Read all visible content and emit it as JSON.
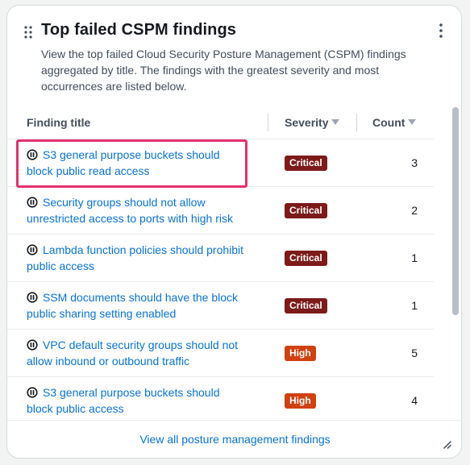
{
  "widget": {
    "title": "Top failed CSPM findings",
    "description": "View the top failed Cloud Security Posture Management (CSPM) findings aggregated by title. The findings with the greatest severity and most occurrences are listed below."
  },
  "table": {
    "columns": {
      "title": "Finding title",
      "severity": "Severity",
      "count": "Count"
    },
    "rows": [
      {
        "title": "S3 general purpose buckets should block public read access",
        "severity": "Critical",
        "count": "3"
      },
      {
        "title": "Security groups should not allow unrestricted access to ports with high risk",
        "severity": "Critical",
        "count": "2"
      },
      {
        "title": "Lambda function policies should prohibit public access",
        "severity": "Critical",
        "count": "1"
      },
      {
        "title": "SSM documents should have the block public sharing setting enabled",
        "severity": "Critical",
        "count": "1"
      },
      {
        "title": "VPC default security groups should not allow inbound or outbound traffic",
        "severity": "High",
        "count": "5"
      },
      {
        "title": "S3 general purpose buckets should block public access",
        "severity": "High",
        "count": "4"
      }
    ]
  },
  "footer": {
    "link": "View all posture management findings"
  },
  "colors": {
    "critical": "#7d1a1a",
    "high": "#d1400f",
    "link": "#0972d3",
    "highlight": "#e6306f"
  },
  "icons": {
    "control": "security-control-icon",
    "drag": "drag-handle-icon",
    "menu": "more-options-icon",
    "resize": "resize-handle-icon"
  }
}
